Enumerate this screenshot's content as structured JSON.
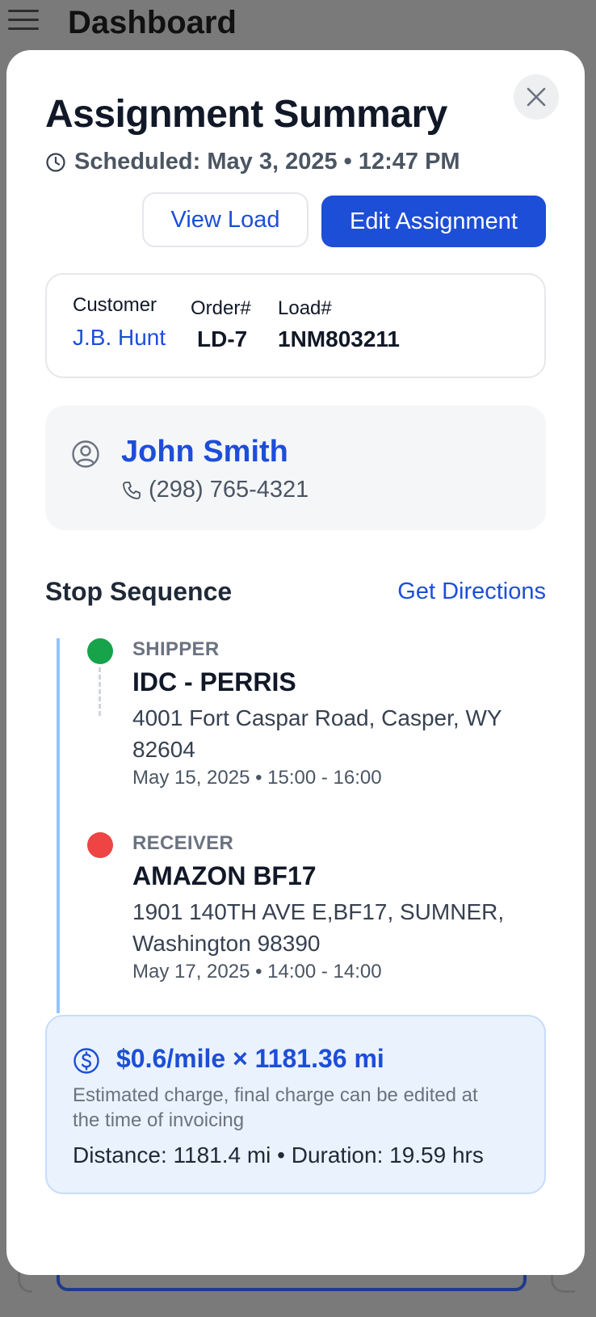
{
  "app": {
    "title": "Dashboard"
  },
  "modal": {
    "title": "Assignment Summary",
    "scheduled": "Scheduled: May 3, 2025 • 12:47 PM",
    "view_load_label": "View Load",
    "edit_assignment_label": "Edit Assignment"
  },
  "info": {
    "customer_label": "Customer",
    "customer_value": "J.B. Hunt",
    "order_label": "Order#",
    "order_value": "LD-7",
    "load_label": "Load#",
    "load_value": "1NM803211"
  },
  "driver": {
    "name": "John Smith",
    "phone": "(298) 765-4321"
  },
  "stops_section": {
    "title": "Stop Sequence",
    "directions_label": "Get Directions",
    "stops": [
      {
        "type": "SHIPPER",
        "name": "IDC - PERRIS",
        "address": "4001 Fort Caspar Road, Casper, WY 82604",
        "time": "May 15, 2025 • 15:00 - 16:00",
        "color": "#16a34a"
      },
      {
        "type": "RECEIVER",
        "name": "AMAZON BF17",
        "address": "1901 140TH AVE E,BF17, SUMNER, Washington 98390",
        "time": "May 17, 2025 • 14:00 - 14:00",
        "color": "#ef4444"
      }
    ]
  },
  "charge": {
    "rate": "$0.6/mile × 1181.36 mi",
    "note": "Estimated charge, final charge can be edited at the time of invoicing",
    "stats": "Distance: 1181.4 mi • Duration: 19.59 hrs"
  },
  "colors": {
    "accent": "#1d4ed8",
    "shipper": "#16a34a",
    "receiver": "#ef4444"
  }
}
